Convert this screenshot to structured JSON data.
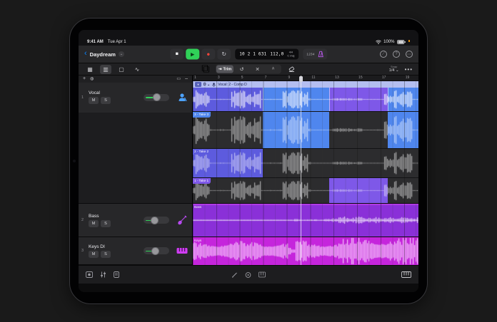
{
  "status_bar": {
    "time": "9:41 AM",
    "date": "Tue Apr 1",
    "battery_percent": "100%"
  },
  "title_bar": {
    "project_name": "Daydream",
    "lcd": {
      "position": "10 2 1 631",
      "tempo": "112,0",
      "time_signature": "4/4",
      "key": "C maj"
    },
    "count_in": "1234"
  },
  "toolbar": {
    "trim_label": "Trim",
    "snap_label": "Snap",
    "snap_value": "1/4 ⌄",
    "more": "•••",
    "add_track": "+"
  },
  "ruler": {
    "labels": [
      "1",
      "3",
      "5",
      "7",
      "9",
      "11",
      "13",
      "15",
      "17",
      "19"
    ],
    "bar_width_fraction": 0.052
  },
  "tracks": [
    {
      "num": "1",
      "name": "Vocal",
      "mute": "M",
      "solo": "S",
      "icon": "vocalist"
    },
    {
      "num": "2",
      "name": "Bass",
      "mute": "M",
      "solo": "S",
      "icon": "bass-guitar"
    },
    {
      "num": "3",
      "name": "Keys DI",
      "mute": "M",
      "solo": "S",
      "icon": "keyboard"
    }
  ],
  "arrange": {
    "comp_region": {
      "label": "Vocal: 2 - Comp D",
      "comp_letter": "D",
      "collapse_glyph": "▾",
      "segments": [
        {
          "from": 0,
          "to": 0.31,
          "color": "#5d5bde"
        },
        {
          "from": 0.31,
          "to": 0.605,
          "color": "#4f86ee"
        },
        {
          "from": 0.605,
          "to": 0.864,
          "color": "#7e58e8"
        },
        {
          "from": 0.864,
          "to": 1,
          "color": "#4f86ee"
        }
      ]
    },
    "take_lanes": [
      {
        "label": "3 - Take 3",
        "color": "#4f86ee",
        "selected": [
          [
            0.31,
            0.605
          ],
          [
            0.864,
            1
          ]
        ]
      },
      {
        "label": "2 - Take 2",
        "color": "#5d5bde",
        "selected": [
          [
            0,
            0.31
          ]
        ]
      },
      {
        "label": "1 - Take 1",
        "color": "#7e58e8",
        "selected": [
          [
            0.605,
            0.864
          ]
        ]
      }
    ],
    "bass_region_label": "Bass",
    "keys_region_label": "Keys",
    "playhead_fraction": 0.479
  },
  "colors": {
    "accent_blue": "#0a84ff",
    "play_green": "#30d158",
    "record_red": "#ff453a",
    "metronome_purple": "#bf5af2",
    "bass_region": "#8a30d8",
    "keys_region": "#c525dc",
    "comp_header": "#b4bef0"
  }
}
